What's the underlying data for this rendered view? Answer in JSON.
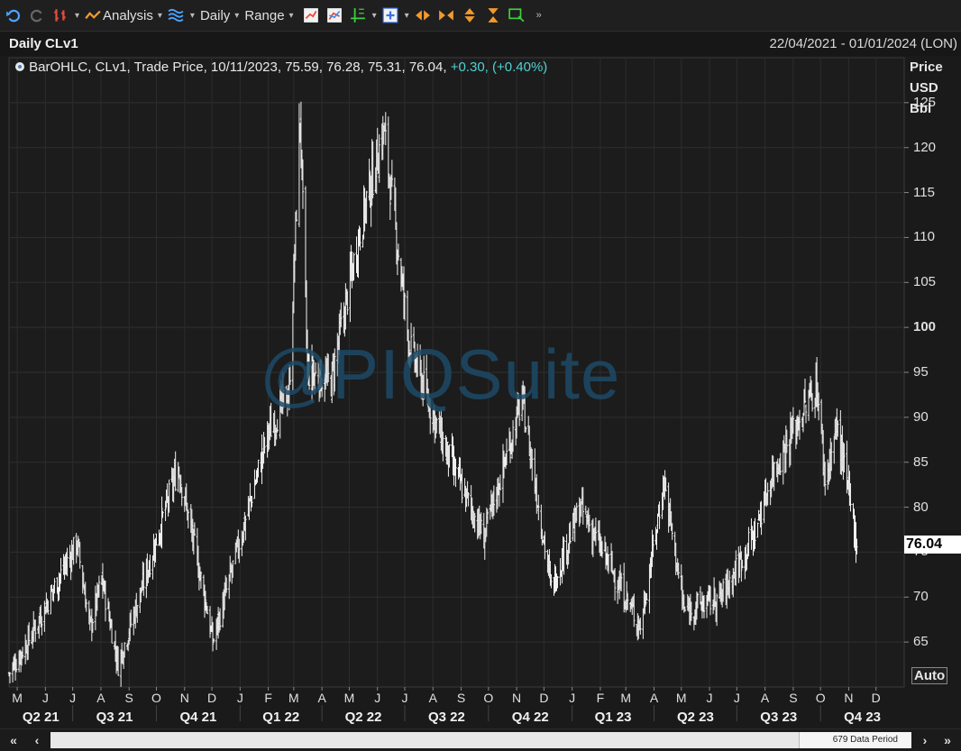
{
  "toolbar": {
    "analysis_label": "Analysis",
    "period_label": "Daily",
    "range_label": "Range"
  },
  "header": {
    "title": "Daily CLv1",
    "date_range": "22/04/2021 - 01/01/2024 (LON)"
  },
  "info": {
    "text": "BarOHLC, CLv1, Trade Price, 10/11/2023, 75.59, 76.28, 75.31, 76.04,",
    "change": "+0.30, (+0.40%)"
  },
  "axis": {
    "title_lines": [
      "Price",
      "USD",
      "Bbl"
    ],
    "auto_label": "Auto"
  },
  "last_price_label": "76.04",
  "watermark": "@PIQSuite",
  "scrollbar": {
    "data_period_label": "679 Data Period"
  },
  "chart_data": {
    "type": "bar",
    "subtype": "ohlc",
    "series_name": "CLv1",
    "ylim": [
      60,
      130
    ],
    "yticks": [
      65,
      70,
      75,
      80,
      85,
      90,
      95,
      100,
      105,
      110,
      115,
      120,
      125
    ],
    "xlim": [
      "2021-04-22",
      "2024-01-01"
    ],
    "grid": true,
    "month_ticks": [
      "M",
      "J",
      "J",
      "A",
      "S",
      "O",
      "N",
      "D",
      "J",
      "F",
      "M",
      "A",
      "M",
      "J",
      "J",
      "A",
      "S",
      "O",
      "N",
      "D",
      "J",
      "F",
      "M",
      "A",
      "M",
      "J",
      "J",
      "A",
      "S",
      "O",
      "N",
      "D"
    ],
    "quarter_ticks": [
      "Q2 21",
      "Q3 21",
      "Q4 21",
      "Q1 22",
      "Q2 22",
      "Q3 22",
      "Q4 22",
      "Q1 23",
      "Q2 23",
      "Q3 23",
      "Q4 23"
    ],
    "anchors": [
      {
        "date": "2021-04-22",
        "close": 61.5
      },
      {
        "date": "2021-05-15",
        "close": 65.5
      },
      {
        "date": "2021-06-20",
        "close": 73
      },
      {
        "date": "2021-07-06",
        "close": 76
      },
      {
        "date": "2021-07-20",
        "close": 66.5
      },
      {
        "date": "2021-08-02",
        "close": 72
      },
      {
        "date": "2021-08-20",
        "close": 62.5
      },
      {
        "date": "2021-09-15",
        "close": 71
      },
      {
        "date": "2021-10-25",
        "close": 84.5
      },
      {
        "date": "2021-11-25",
        "close": 69
      },
      {
        "date": "2021-12-02",
        "close": 65
      },
      {
        "date": "2021-12-31",
        "close": 76
      },
      {
        "date": "2022-01-31",
        "close": 88
      },
      {
        "date": "2022-02-24",
        "close": 93
      },
      {
        "date": "2022-03-08",
        "close": 123.7
      },
      {
        "date": "2022-03-16",
        "close": 95
      },
      {
        "date": "2022-04-11",
        "close": 94
      },
      {
        "date": "2022-05-15",
        "close": 112
      },
      {
        "date": "2022-06-08",
        "close": 122
      },
      {
        "date": "2022-07-06",
        "close": 98
      },
      {
        "date": "2022-08-16",
        "close": 86
      },
      {
        "date": "2022-09-26",
        "close": 76.7
      },
      {
        "date": "2022-11-07",
        "close": 92
      },
      {
        "date": "2022-12-09",
        "close": 71
      },
      {
        "date": "2023-01-10",
        "close": 80
      },
      {
        "date": "2023-03-17",
        "close": 66.7
      },
      {
        "date": "2023-04-12",
        "close": 83
      },
      {
        "date": "2023-05-04",
        "close": 68.5
      },
      {
        "date": "2023-06-14",
        "close": 70
      },
      {
        "date": "2023-07-20",
        "close": 77
      },
      {
        "date": "2023-08-10",
        "close": 84
      },
      {
        "date": "2023-09-27",
        "close": 93.7
      },
      {
        "date": "2023-10-06",
        "close": 83
      },
      {
        "date": "2023-10-19",
        "close": 89
      },
      {
        "date": "2023-11-10",
        "close": 76.04
      }
    ]
  }
}
